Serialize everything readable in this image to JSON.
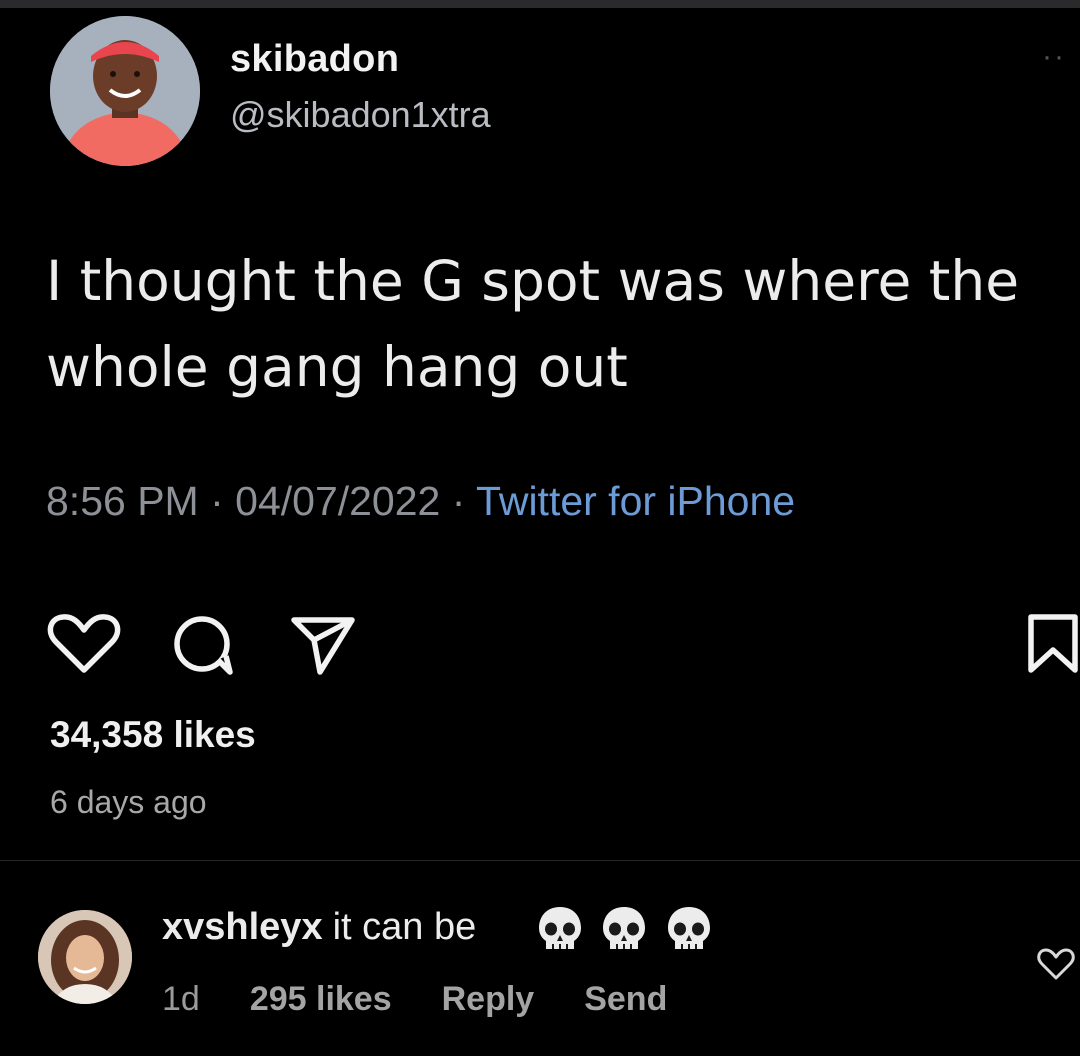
{
  "tweet": {
    "display_name": "skibadon",
    "handle": "@skibadon1xtra",
    "text_line1": "I thought the G spot was where the",
    "text_line2": "whole gang hang out",
    "time": "8:56 PM",
    "date": "04/07/2022",
    "separator": " · ",
    "source": "Twitter for iPhone",
    "more_label": "··"
  },
  "post": {
    "likes": "34,358 likes",
    "time_ago": "6 days ago"
  },
  "comment": {
    "username": "xvshleyx",
    "text": "it can be",
    "emoji": [
      "skull",
      "skull",
      "skull"
    ],
    "age": "1d",
    "likes": "295 likes",
    "reply_label": "Reply",
    "send_label": "Send"
  },
  "colors": {
    "background": "#000000",
    "link_blue": "#6c9bd6",
    "muted": "#8d9096",
    "avatar_shirt": "#f26b63",
    "avatar_bandana": "#e8454f"
  },
  "icons": [
    "heart-icon",
    "comment-icon",
    "share-icon",
    "bookmark-icon",
    "skull-icon",
    "small-heart-icon"
  ]
}
